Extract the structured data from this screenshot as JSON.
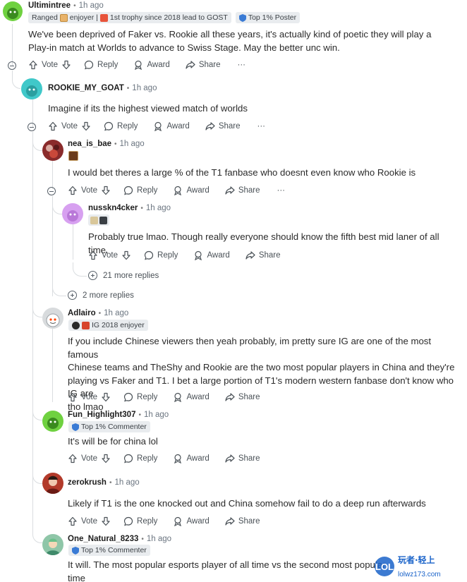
{
  "actions": {
    "vote": "Vote",
    "reply": "Reply",
    "award": "Award",
    "share": "Share",
    "more": "···"
  },
  "comments": [
    {
      "username": "Ultimintree",
      "time": "1h ago",
      "flairs": [
        {
          "text": "Ranged",
          "icon": ""
        },
        {
          "text": "enjoyer | ",
          "icon": "plant-flair-icon"
        },
        {
          "text": "1st trophy since 2018 lead to GOST",
          "icon": "trophy-flair-icon"
        },
        {
          "text": "Top 1% Poster",
          "icon": "shield-flair-icon"
        }
      ],
      "body": "We've been deprived of Faker vs. Rookie all these years, it's actually kind of poetic they will play a Play-in match at Worlds to advance to Swiss Stage. May the better unc win.",
      "avatar_color": "#6fd140"
    },
    {
      "username": "ROOKIE_MY_GOAT",
      "time": "1h ago",
      "body": "Imagine if its the highest viewed match of worlds",
      "avatar_color": "#40c8c9"
    },
    {
      "username": "nea_is_bae",
      "time": "1h ago",
      "body": "I would bet theres a large % of the T1 fanbase who doesnt even know who Rookie is",
      "avatar_color": "#8a2b2b"
    },
    {
      "username": "nusskn4cker",
      "time": "1h ago",
      "body": "Probably true lmao. Though really everyone should know the fifth best mid laner of all time.",
      "avatar_color": "#d7a0f0"
    },
    {
      "username": "Adlairo",
      "time": "1h ago",
      "flair": "IG 2018 enjoyer",
      "body_lines": [
        "If you include Chinese viewers then yeah probably, im pretty sure IG are one of the most famous",
        "Chinese teams and TheShy and Rookie are the two most popular players in China and they're",
        "playing vs Faker and T1. I bet a large portion of T1's modern western fanbase don't know who IG are",
        "tho lmao"
      ],
      "avatar_color": "#d8dbdd"
    },
    {
      "username": "Fun_Highlight307",
      "time": "1h ago",
      "flair": "Top 1% Commenter",
      "body": "It's will be for china lol",
      "avatar_color": "#6fd140"
    },
    {
      "username": "zerokrush",
      "time": "1h ago",
      "body": "Likely if T1 is the one knocked out and China somehow fail to do a deep run afterwards",
      "avatar_color": "#b23a2a"
    },
    {
      "username": "One_Natural_8233",
      "time": "1h ago",
      "flair": "Top 1% Commenter",
      "body_lines": [
        "It will. The most popular esports player of all time vs the second most popular",
        "time"
      ],
      "avatar_color": "#8fc6a8"
    }
  ],
  "more_replies": [
    {
      "text": "21 more replies"
    },
    {
      "text": "2 more replies"
    }
  ],
  "watermark": {
    "logo": "LOL",
    "site": "lolwz173.com",
    "tag": "玩者·轻上"
  },
  "colors": {
    "line": "#dadde0",
    "text": "#1c1c1c",
    "meta": "#6b7580",
    "flair_bg": "#e9ecef"
  }
}
